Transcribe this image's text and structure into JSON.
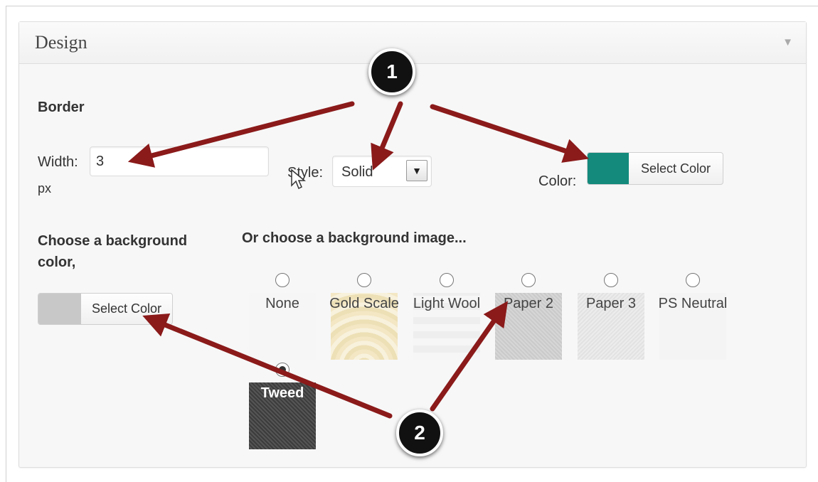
{
  "panel": {
    "title": "Design",
    "toggle_icon": "triangle-down-icon"
  },
  "border": {
    "heading": "Border",
    "width_label": "Width:",
    "width_value": "3",
    "width_unit": "px",
    "style_label": "Style:",
    "style_value": "Solid",
    "color_label": "Color:",
    "color_value": "#138a7c",
    "select_color_label": "Select Color"
  },
  "background": {
    "color_heading": "Choose a background color,",
    "image_heading": "Or choose a background image...",
    "select_color_label": "Select Color",
    "color_value": "#c8c8c8",
    "images": [
      {
        "label": "None",
        "checked": false
      },
      {
        "label": "Gold Scale",
        "checked": false
      },
      {
        "label": "Light Wool",
        "checked": false
      },
      {
        "label": "Paper 2",
        "checked": false
      },
      {
        "label": "Paper 3",
        "checked": false
      },
      {
        "label": "PS Neutral",
        "checked": false
      },
      {
        "label": "Tweed",
        "checked": true
      }
    ]
  },
  "annotations": {
    "marker_1": "1",
    "marker_2": "2",
    "arrow_color": "#8b1a1a"
  }
}
